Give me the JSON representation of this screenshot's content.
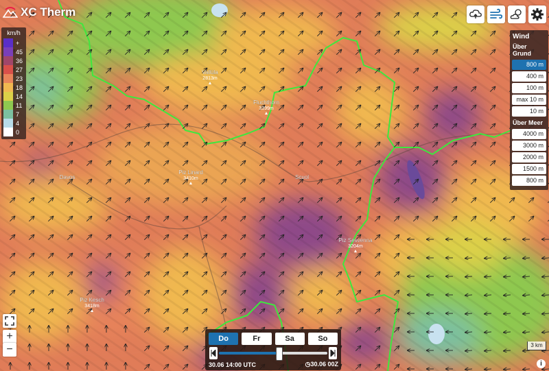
{
  "app": {
    "title": "XC Therm"
  },
  "legend": {
    "unit": "km/h",
    "items": [
      {
        "label": "+",
        "color": "#5a2ec8"
      },
      {
        "label": "45",
        "color": "#7a3fb8"
      },
      {
        "label": "36",
        "color": "#a0466a"
      },
      {
        "label": "27",
        "color": "#d9504a"
      },
      {
        "label": "23",
        "color": "#e8845a"
      },
      {
        "label": "18",
        "color": "#f0b850"
      },
      {
        "label": "14",
        "color": "#dcd048"
      },
      {
        "label": "11",
        "color": "#8ec850"
      },
      {
        "label": "7",
        "color": "#7cc0a0"
      },
      {
        "label": "4",
        "color": "#b8dce8"
      },
      {
        "label": "0",
        "color": "#ffffff"
      }
    ]
  },
  "toolbar": {
    "buttons": [
      {
        "name": "cloud-thermal-icon"
      },
      {
        "name": "wind-icon",
        "active": true
      },
      {
        "name": "weather-icon"
      },
      {
        "name": "settings-gear-icon"
      }
    ]
  },
  "wind_panel": {
    "title": "Wind",
    "above_ground_label": "Über Grund",
    "above_ground_options": [
      "800 m",
      "400 m",
      "100 m",
      "max 10 m",
      "10 m"
    ],
    "above_ground_selected": "800 m",
    "above_sea_label": "Über Meer",
    "above_sea_options": [
      "4000 m",
      "3000 m",
      "2000 m",
      "1500 m",
      "800 m"
    ]
  },
  "map_labels": [
    {
      "name": "Vallüla",
      "elev": "2813m"
    },
    {
      "name": "Fluchthorn",
      "elev": "3399m"
    },
    {
      "name": "Piz Linard",
      "elev": "3410m"
    },
    {
      "name": "Davos",
      "elev": ""
    },
    {
      "name": "Scuol",
      "elev": ""
    },
    {
      "name": "Piz Sesvenna",
      "elev": "3204m"
    },
    {
      "name": "Piz Kesch",
      "elev": "3418m"
    }
  ],
  "map_controls": {
    "fullscreen": "⛶",
    "zoom_in": "+",
    "zoom_out": "−"
  },
  "time": {
    "days": [
      "Do",
      "Fr",
      "Sa",
      "So"
    ],
    "selected_day": "Do",
    "current_label": "30.06 14:00 UTC",
    "run_label": "30.06 00Z",
    "position_fraction": 0.55
  },
  "scale": {
    "label": "3 km"
  },
  "info": {
    "label": "i"
  },
  "colors": {
    "accent": "#1e72b0",
    "border": "#3ee83e"
  }
}
